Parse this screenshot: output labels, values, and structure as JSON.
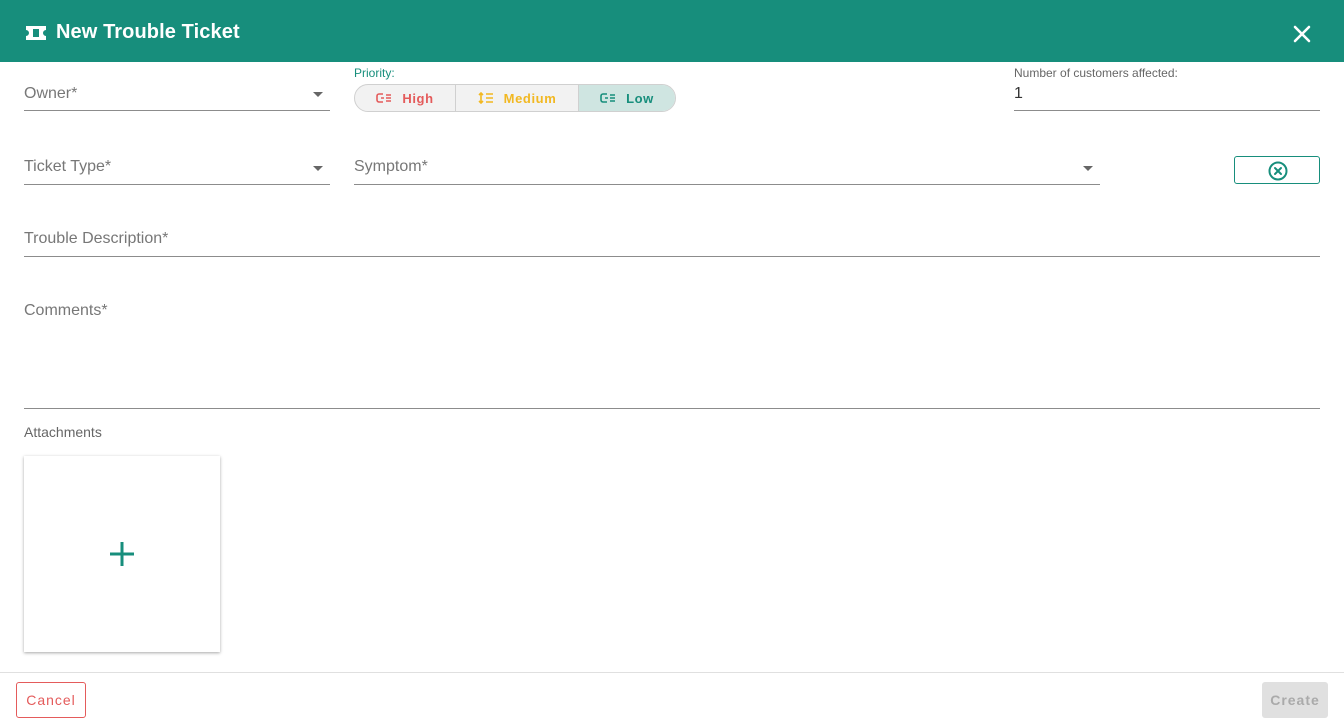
{
  "dialog": {
    "title": "New Trouble Ticket",
    "header_icon": "ticket-icon",
    "close_icon": "close-icon",
    "accent_color": "#178e7c"
  },
  "form": {
    "owner": {
      "placeholder": "Owner*",
      "value": ""
    },
    "priority": {
      "label": "Priority:",
      "options": [
        {
          "label": "High",
          "icon": "priority-high-icon",
          "color": "#e45b5b"
        },
        {
          "label": "Medium",
          "icon": "priority-medium-icon",
          "color": "#f2b821"
        },
        {
          "label": "Low",
          "icon": "priority-low-icon",
          "color": "#178e7c"
        }
      ],
      "selected": "Low"
    },
    "customers_affected": {
      "label": "Number of customers affected:",
      "value": "1"
    },
    "ticket_type": {
      "placeholder": "Ticket Type*",
      "value": ""
    },
    "symptom": {
      "placeholder": "Symptom*",
      "value": ""
    },
    "clear_icon": "clear-circle-icon",
    "trouble_description": {
      "placeholder": "Trouble Description*",
      "value": ""
    },
    "comments": {
      "placeholder": "Comments*",
      "value": ""
    },
    "attachments": {
      "label": "Attachments",
      "add_icon": "plus-icon"
    }
  },
  "footer": {
    "cancel_label": "Cancel",
    "create_label": "Create",
    "cancel_color": "#e45b5b"
  }
}
